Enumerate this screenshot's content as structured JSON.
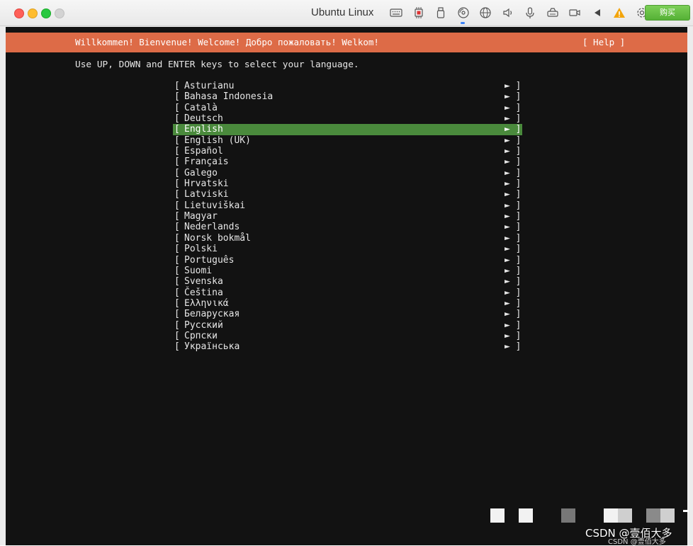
{
  "window": {
    "title": "Ubuntu Linux",
    "buy_label": "购买"
  },
  "toolbar_icons": [
    "keyboard-icon",
    "cpu-icon",
    "usb-icon",
    "disc-icon",
    "network-icon",
    "speaker-icon",
    "microphone-icon",
    "printer-icon",
    "camera-icon",
    "back-icon",
    "warning-icon",
    "settings-icon"
  ],
  "installer": {
    "header_title": "Willkommen! Bienvenue! Welcome! Добро пожаловать! Welkom!",
    "help_label": "[ Help ]",
    "instruction": "Use UP, DOWN and ENTER keys to select your language.",
    "languages": [
      "Asturianu",
      "Bahasa Indonesia",
      "Català",
      "Deutsch",
      "English",
      "English (UK)",
      "Español",
      "Français",
      "Galego",
      "Hrvatski",
      "Latviski",
      "Lietuviškai",
      "Magyar",
      "Nederlands",
      "Norsk bokmål",
      "Polski",
      "Português",
      "Suomi",
      "Svenska",
      "Čeština",
      "Ελληνικά",
      "Беларуская",
      "Русский",
      "Српски",
      "Українська"
    ],
    "selected_language": "English",
    "left_bracket": "[",
    "right_marker": "► ]"
  },
  "colors": {
    "header_bg": "#dd6b47",
    "selected_bg": "#4a8a3c",
    "terminal_bg": "#121212"
  },
  "watermark": {
    "main": "CSDN @壹佰大多",
    "small": "CSDN @壹佰大多"
  }
}
